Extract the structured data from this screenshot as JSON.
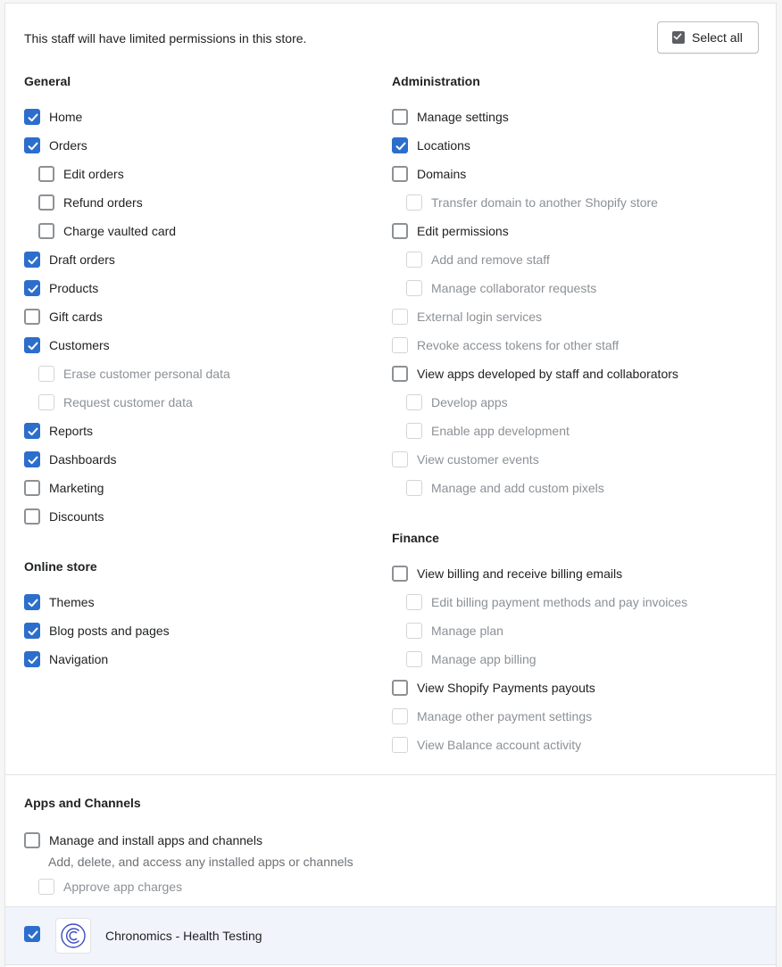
{
  "intro": "This staff will have limited permissions in this store.",
  "select_all": "Select all",
  "general": {
    "heading": "General",
    "items": [
      {
        "label": "Home",
        "checked": true,
        "disabled": false
      },
      {
        "label": "Orders",
        "checked": true,
        "disabled": false
      },
      {
        "label": "Edit orders",
        "checked": false,
        "disabled": false
      },
      {
        "label": "Refund orders",
        "checked": false,
        "disabled": false
      },
      {
        "label": "Charge vaulted card",
        "checked": false,
        "disabled": false
      },
      {
        "label": "Draft orders",
        "checked": true,
        "disabled": false
      },
      {
        "label": "Products",
        "checked": true,
        "disabled": false
      },
      {
        "label": "Gift cards",
        "checked": false,
        "disabled": false
      },
      {
        "label": "Customers",
        "checked": true,
        "disabled": false
      },
      {
        "label": "Erase customer personal data",
        "checked": false,
        "disabled": true
      },
      {
        "label": "Request customer data",
        "checked": false,
        "disabled": true
      },
      {
        "label": "Reports",
        "checked": true,
        "disabled": false
      },
      {
        "label": "Dashboards",
        "checked": true,
        "disabled": false
      },
      {
        "label": "Marketing",
        "checked": false,
        "disabled": false
      },
      {
        "label": "Discounts",
        "checked": false,
        "disabled": false
      }
    ]
  },
  "online_store": {
    "heading": "Online store",
    "items": [
      {
        "label": "Themes",
        "checked": true,
        "disabled": false
      },
      {
        "label": "Blog posts and pages",
        "checked": true,
        "disabled": false
      },
      {
        "label": "Navigation",
        "checked": true,
        "disabled": false
      }
    ]
  },
  "administration": {
    "heading": "Administration",
    "items": [
      {
        "label": "Manage settings",
        "checked": false,
        "disabled": false
      },
      {
        "label": "Locations",
        "checked": true,
        "disabled": false
      },
      {
        "label": "Domains",
        "checked": false,
        "disabled": false
      },
      {
        "label": "Transfer domain to another Shopify store",
        "checked": false,
        "disabled": true
      },
      {
        "label": "Edit permissions",
        "checked": false,
        "disabled": false
      },
      {
        "label": "Add and remove staff",
        "checked": false,
        "disabled": true
      },
      {
        "label": "Manage collaborator requests",
        "checked": false,
        "disabled": true
      },
      {
        "label": "External login services",
        "checked": false,
        "disabled": true
      },
      {
        "label": "Revoke access tokens for other staff",
        "checked": false,
        "disabled": true
      },
      {
        "label": "View apps developed by staff and collaborators",
        "checked": false,
        "disabled": false
      },
      {
        "label": "Develop apps",
        "checked": false,
        "disabled": true
      },
      {
        "label": "Enable app development",
        "checked": false,
        "disabled": true
      },
      {
        "label": "View customer events",
        "checked": false,
        "disabled": true
      },
      {
        "label": "Manage and add custom pixels",
        "checked": false,
        "disabled": true
      }
    ]
  },
  "finance": {
    "heading": "Finance",
    "items": [
      {
        "label": "View billing and receive billing emails",
        "checked": false,
        "disabled": false
      },
      {
        "label": "Edit billing payment methods and pay invoices",
        "checked": false,
        "disabled": true
      },
      {
        "label": "Manage plan",
        "checked": false,
        "disabled": true
      },
      {
        "label": "Manage app billing",
        "checked": false,
        "disabled": true
      },
      {
        "label": "View Shopify Payments payouts",
        "checked": false,
        "disabled": false
      },
      {
        "label": "Manage other payment settings",
        "checked": false,
        "disabled": true
      },
      {
        "label": "View Balance account activity",
        "checked": false,
        "disabled": true
      }
    ]
  },
  "apps_channels": {
    "heading": "Apps and Channels",
    "manage": {
      "label": "Manage and install apps and channels",
      "checked": false,
      "disabled": false
    },
    "help": "Add, delete, and access any installed apps or channels",
    "approve": {
      "label": "Approve app charges",
      "checked": false,
      "disabled": true
    }
  },
  "app": {
    "name": "Chronomics - Health Testing",
    "checked": true,
    "icon": "chronomics-logo"
  },
  "colors": {
    "accent": "#2c6ecb",
    "app_row_bg": "#f1f4fb"
  }
}
